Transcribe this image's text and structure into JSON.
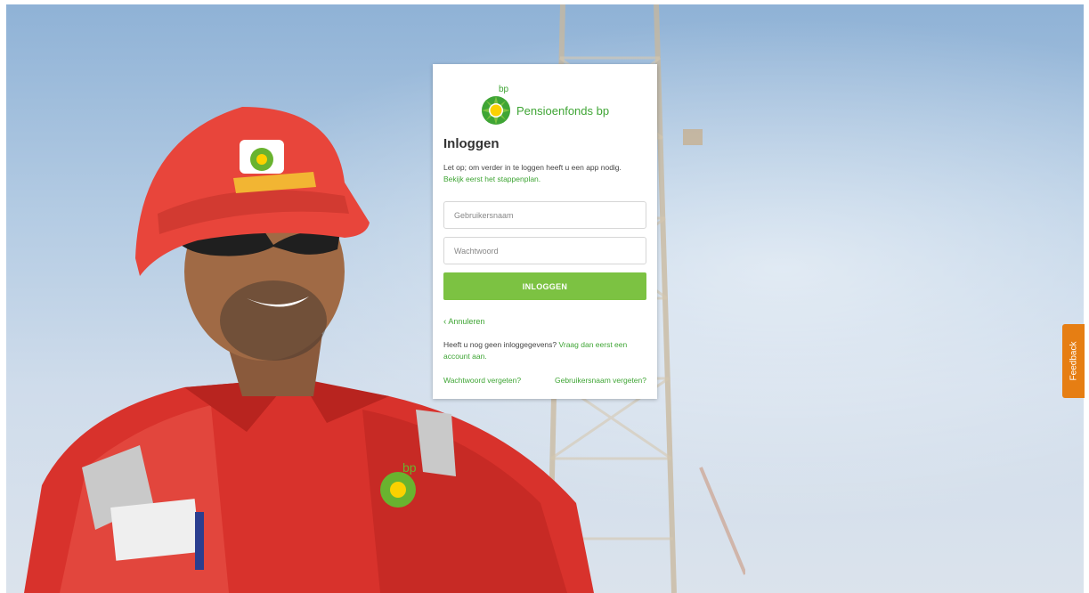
{
  "colors": {
    "brand_green": "#3fa535",
    "button_green": "#7cc242",
    "feedback_orange": "#e67e13",
    "helmet_red": "#e8453b"
  },
  "brand": {
    "logo_small_text": "bp",
    "name": "Pensioenfonds bp",
    "logo_icon": "bp-helios-icon"
  },
  "login": {
    "title": "Inloggen",
    "notice_text": "Let op; om verder in te loggen heeft u een app nodig.",
    "notice_link": "Bekijk eerst het stappenplan.",
    "username_placeholder": "Gebruikersnaam",
    "password_placeholder": "Wachtwoord",
    "submit_label": "INLOGGEN",
    "cancel_label": "Annuleren",
    "no_account_text": "Heeft u nog geen inloggegevens?",
    "no_account_link": "Vraag dan eerst een account aan.",
    "forgot_password": "Wachtwoord vergeten?",
    "forgot_username": "Gebruikersnaam vergeten?"
  },
  "feedback": {
    "label": "Feedback"
  }
}
